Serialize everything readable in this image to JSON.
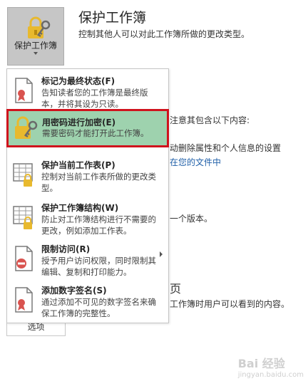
{
  "protect_button": {
    "label": "保护工作簿",
    "icon": "lock-key-icon"
  },
  "section": {
    "title": "保护工作簿",
    "description": "控制其他人可以对此工作簿所做的更改类型。"
  },
  "background": {
    "line1": "注意其包含以下内容:",
    "line2": "动删除属性和个人信息的设置",
    "line3": "在您的文件中",
    "line4": "一个版本。",
    "line5": "页",
    "line6": "工作簿时用户可以看到的内容。",
    "options_label": "选项"
  },
  "menu": {
    "items": [
      {
        "title": "标记为最终状态(F)",
        "desc": "告知读者您的工作簿是最终版本，并将其设为只读。",
        "icon": "document-ribbon-icon"
      },
      {
        "title": "用密码进行加密(E)",
        "desc": "需要密码才能打开此工作簿。",
        "icon": "lock-key-icon"
      },
      {
        "title": "保护当前工作表(P)",
        "desc": "控制对当前工作表所做的更改类型。",
        "icon": "sheet-lock-icon"
      },
      {
        "title": "保护工作簿结构(W)",
        "desc": "防止对工作簿结构进行不需要的更改，例如添加工作表。",
        "icon": "sheet-lock-icon"
      },
      {
        "title": "限制访问(R)",
        "desc": "授予用户访问权限，同时限制其编辑、复制和打印能力。",
        "icon": "document-restrict-icon"
      },
      {
        "title": "添加数字签名(S)",
        "desc": "通过添加不可见的数字签名来确保工作簿的完整性。",
        "icon": "document-signature-icon"
      }
    ]
  },
  "watermark": {
    "text": "Bai 经验",
    "sub": "jingyan.baidu.com"
  },
  "colors": {
    "highlight": "#9ed2ae",
    "highlight_border": "#d0121d",
    "lock": "#e8b92e"
  }
}
